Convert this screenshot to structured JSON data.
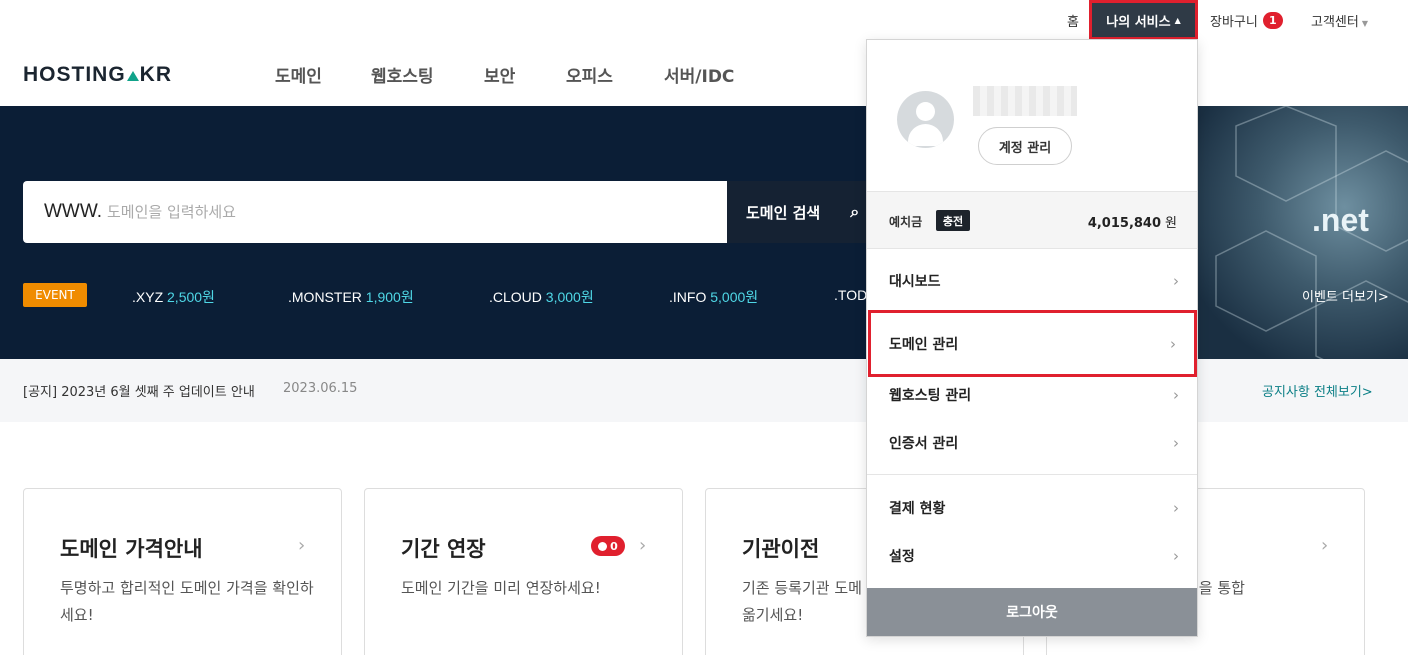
{
  "topbar": {
    "home": "홈",
    "my_service": "나의 서비스",
    "cart": "장바구니",
    "cart_count": "1",
    "customer_center": "고객센터"
  },
  "header": {
    "logo_left": "HOSTING",
    "logo_right": "KR",
    "nav": [
      "도메인",
      "웹호스팅",
      "보안",
      "오피스",
      "서버/IDC"
    ]
  },
  "hero": {
    "search_prefix": "WWW.",
    "search_placeholder": "도메인을 입력하세요",
    "search_button": "도메인 검색",
    "event_badge": "EVENT",
    "events": [
      {
        "tld": ".XYZ",
        "price": "2,500원"
      },
      {
        "tld": ".MONSTER",
        "price": "1,900원"
      },
      {
        "tld": ".CLOUD",
        "price": "3,000원"
      },
      {
        "tld": ".INFO",
        "price": "5,000원"
      },
      {
        "tld": ".TOD",
        "price": ""
      }
    ],
    "banner_text": ".net",
    "event_more": "이벤트 더보기>"
  },
  "notice": {
    "text": "[공지] 2023년 6월 셋째 주 업데이트 안내",
    "date": "2023.06.15",
    "view_all": "공지사항 전체보기>"
  },
  "cards": [
    {
      "title": "도메인 가격안내",
      "desc": "투명하고 합리적인 도메인 가격을 확인하세요!"
    },
    {
      "title": "기간 연장",
      "desc": "도메인 기간을 미리 연장하세요!",
      "badge": "0"
    },
    {
      "title": "기관이전",
      "desc": "기존 등록기관 도메\n옮기세요!"
    },
    {
      "title": "",
      "desc": "인을 통합"
    }
  ],
  "dropdown": {
    "account_button": "계정 관리",
    "balance_label": "예치금",
    "charge_button": "충전",
    "balance_amount": "4,015,840",
    "balance_unit": "원",
    "items": [
      {
        "label": "대시보드"
      },
      {
        "label": "도메인 관리"
      },
      {
        "label": "웹호스팅 관리"
      },
      {
        "label": "인증서 관리"
      },
      {
        "label": "결제 현황"
      },
      {
        "label": "설정"
      }
    ],
    "logout": "로그아웃",
    "highlight_color": "#e0202e"
  },
  "colors": {
    "hero_bg": "#0b1e36",
    "accent_price": "#4fd7e6",
    "event_orange": "#f08c00",
    "notice_link": "#0b7f86"
  }
}
